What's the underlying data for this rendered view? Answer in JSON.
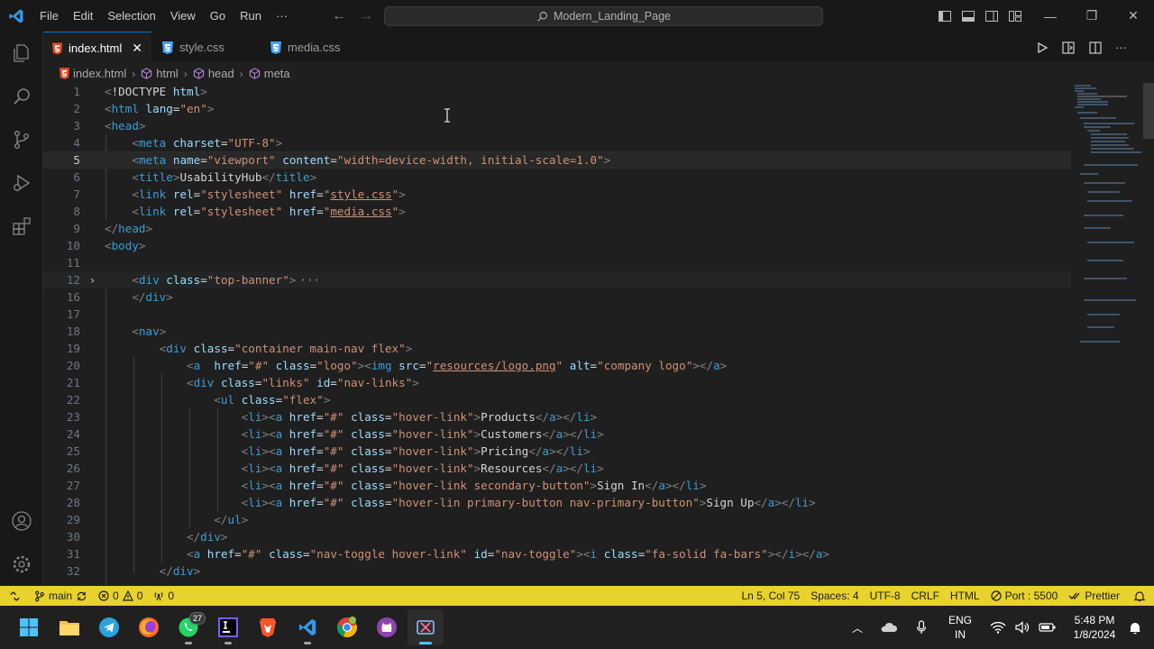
{
  "titlebar": {
    "menu": [
      "File",
      "Edit",
      "Selection",
      "View",
      "Go",
      "Run",
      "···"
    ],
    "search_text": "Modern_Landing_Page"
  },
  "tabs": [
    {
      "label": "index.html",
      "active": true,
      "icon": "html5-icon"
    },
    {
      "label": "style.css",
      "active": false,
      "icon": "css3-icon"
    },
    {
      "label": "media.css",
      "active": false,
      "icon": "css3-icon"
    }
  ],
  "breadcrumb": [
    "index.html",
    "html",
    "head",
    "meta"
  ],
  "editor": {
    "current_line": 5,
    "lines": [
      {
        "n": "1"
      },
      {
        "n": "2"
      },
      {
        "n": "3"
      },
      {
        "n": "4"
      },
      {
        "n": "5"
      },
      {
        "n": "6"
      },
      {
        "n": "7"
      },
      {
        "n": "8"
      },
      {
        "n": "9"
      },
      {
        "n": "10"
      },
      {
        "n": "11"
      },
      {
        "n": "12"
      },
      {
        "n": "16"
      },
      {
        "n": "17"
      },
      {
        "n": "18"
      },
      {
        "n": "19"
      },
      {
        "n": "20"
      },
      {
        "n": "21"
      },
      {
        "n": "22"
      },
      {
        "n": "23"
      },
      {
        "n": "24"
      },
      {
        "n": "25"
      },
      {
        "n": "26"
      },
      {
        "n": "27"
      },
      {
        "n": "28"
      },
      {
        "n": "29"
      },
      {
        "n": "30"
      },
      {
        "n": "31"
      },
      {
        "n": "32"
      }
    ]
  },
  "statusbar": {
    "branch": "main",
    "errors": "0",
    "warnings": "0",
    "ports": "0",
    "position": "Ln 5, Col 75",
    "spaces": "Spaces: 4",
    "encoding": "UTF-8",
    "eol": "CRLF",
    "language": "HTML",
    "port": "Port : 5500",
    "prettier": "Prettier"
  },
  "taskbar": {
    "whatsapp_badge": "27",
    "lang_top": "ENG",
    "lang_bottom": "IN",
    "time": "5:48 PM",
    "date": "1/8/2024"
  },
  "colors": {
    "accent": "#0078d4",
    "statusbar": "#e8d22d",
    "tag": "#3c9cd7",
    "attribute": "#9cdcfe",
    "string": "#ce9178"
  }
}
